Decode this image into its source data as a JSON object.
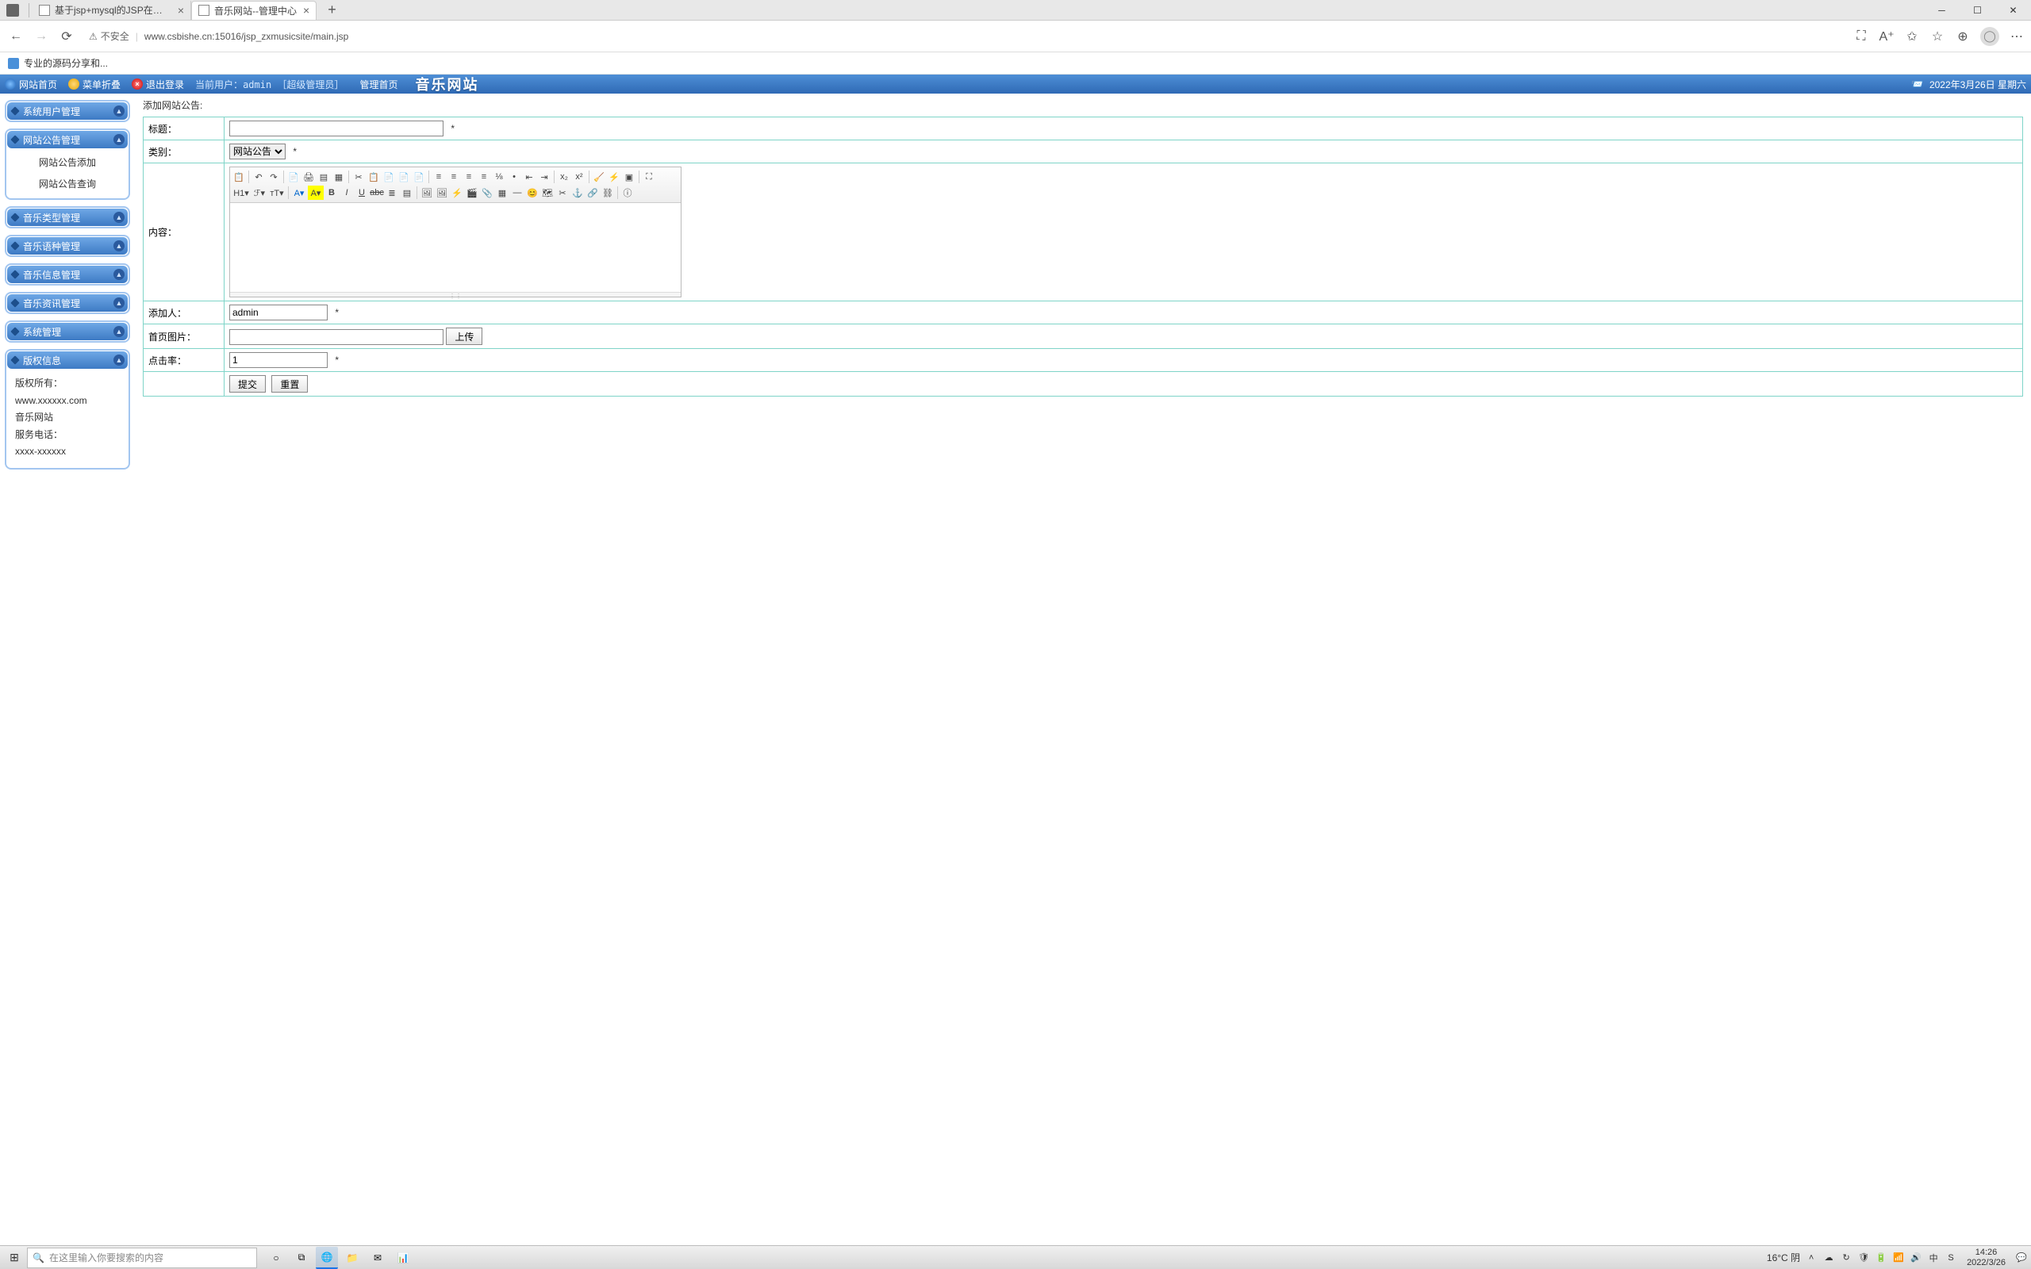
{
  "browser": {
    "tabs": [
      {
        "title": "基于jsp+mysql的JSP在线音乐查",
        "active": false
      },
      {
        "title": "音乐网站--管理中心",
        "active": true
      }
    ],
    "url_warning": "不安全",
    "url": "www.csbishe.cn:15016/jsp_zxmusicsite/main.jsp",
    "bookmark": "专业的源码分享和..."
  },
  "header": {
    "home": "网站首页",
    "menu_toggle": "菜单折叠",
    "logout": "退出登录",
    "current_user_label": "当前用户：",
    "current_user_name": "admin",
    "current_user_role": "［超级管理员］",
    "admin_home": "管理首页",
    "app_title": "音乐网站",
    "date": "2022年3月26日 星期六"
  },
  "sidebar": {
    "panels": [
      {
        "title": "系统用户管理",
        "items": []
      },
      {
        "title": "网站公告管理",
        "items": [
          "网站公告添加",
          "网站公告查询"
        ],
        "expanded": true
      },
      {
        "title": "音乐类型管理",
        "items": []
      },
      {
        "title": "音乐语种管理",
        "items": []
      },
      {
        "title": "音乐信息管理",
        "items": []
      },
      {
        "title": "音乐资讯管理",
        "items": []
      },
      {
        "title": "系统管理",
        "items": []
      }
    ],
    "copyright": {
      "title": "版权信息",
      "owner_label": "版权所有：",
      "site": "www.xxxxxx.com",
      "name": "音乐网站",
      "phone_label": "服务电话：",
      "phone": "xxxx-xxxxxx"
    }
  },
  "form": {
    "page_title": "添加网站公告:",
    "labels": {
      "title": "标题：",
      "category": "类别：",
      "content": "内容：",
      "adder": "添加人：",
      "thumb": "首页图片：",
      "hits": "点击率："
    },
    "category_option": "网站公告",
    "adder_value": "admin",
    "hits_value": "1",
    "upload_btn": "上传",
    "submit_btn": "提交",
    "reset_btn": "重置",
    "required": "*"
  },
  "taskbar": {
    "search_placeholder": "在这里输入你要搜索的内容",
    "weather": "16°C 阴",
    "time": "14:26",
    "date": "2022/3/26"
  }
}
